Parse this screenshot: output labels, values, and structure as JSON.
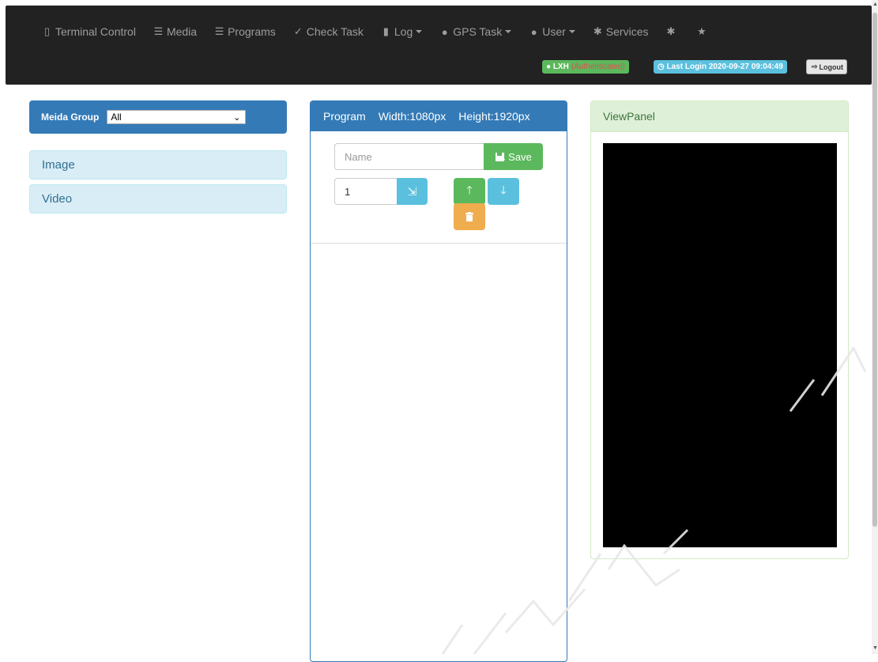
{
  "navbar": {
    "items": [
      {
        "label": "Terminal Control",
        "icon": "tablet-icon",
        "glyph": "▯"
      },
      {
        "label": "Media",
        "icon": "media-icon",
        "glyph": "☰"
      },
      {
        "label": "Programs",
        "icon": "programs-icon",
        "glyph": "☰"
      },
      {
        "label": "Check Task",
        "icon": "check-circle-icon",
        "glyph": "✓"
      },
      {
        "label": "Log",
        "icon": "file-icon",
        "glyph": "▮",
        "dropdown": true
      },
      {
        "label": "GPS Task",
        "icon": "globe-icon",
        "glyph": "●",
        "dropdown": true
      },
      {
        "label": "User",
        "icon": "user-icon",
        "glyph": "●",
        "dropdown": true
      },
      {
        "label": "Services",
        "icon": "asterisk-icon",
        "glyph": "✱"
      },
      {
        "label": "",
        "icon": "asterisk-icon",
        "glyph": "✱"
      },
      {
        "label": "",
        "icon": "star-icon",
        "glyph": "★"
      }
    ],
    "user_badge": {
      "name": "LXH",
      "status": "(Authenticated)"
    },
    "login_badge": "Last Login 2020-09-27 09:04:49",
    "logout_label": "Logout"
  },
  "media_group": {
    "label": "Meida Group",
    "selected": "All"
  },
  "categories": [
    "Image",
    "Video"
  ],
  "program_panel": {
    "title": "Program",
    "width_text": "Width:1080px",
    "height_text": "Height:1920px",
    "name_placeholder": "Name",
    "save_label": "Save",
    "index_value": "1"
  },
  "view_panel": {
    "title": "ViewPanel"
  },
  "colors": {
    "navbar_bg": "#222222",
    "primary": "#337ab7",
    "success": "#5cb85c",
    "info": "#5bc0de",
    "warning": "#f0ad4e"
  }
}
